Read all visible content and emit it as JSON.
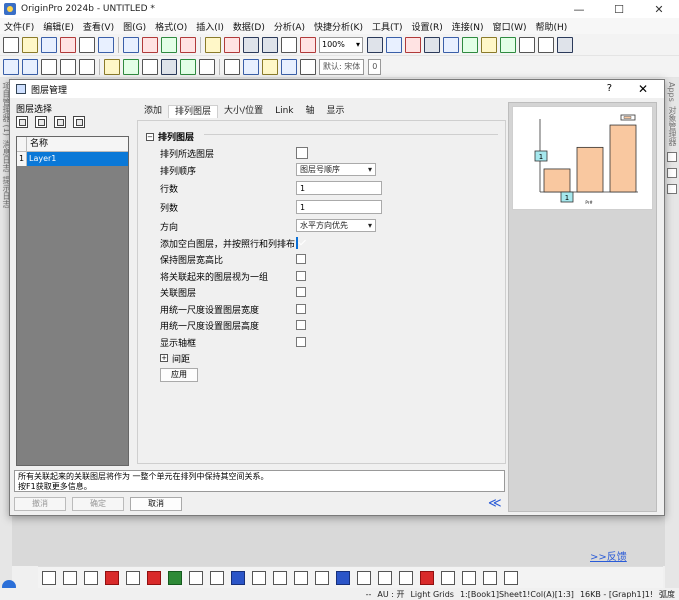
{
  "app": {
    "title": "OriginPro 2024b - UNTITLED *",
    "window_buttons": [
      "—",
      "☐",
      "✕"
    ]
  },
  "menu": [
    "文件(F)",
    "编辑(E)",
    "查看(V)",
    "图(G)",
    "格式(O)",
    "插入(I)",
    "数据(D)",
    "分析(A)",
    "快捷分析(K)",
    "工具(T)",
    "设置(R)",
    "连接(N)",
    "窗口(W)",
    "帮助(H)"
  ],
  "toolbar": {
    "zoom": "100%",
    "font": "默认: 宋体",
    "font_size": "0"
  },
  "side_panels": {
    "left": [
      "项目管理器 (1)",
      "消息日志",
      "提示日志"
    ],
    "right": [
      "Apps",
      "对象管理器"
    ]
  },
  "dialog": {
    "title": "图层管理",
    "help": "?",
    "close": "✕",
    "layer_select_label": "图层选择",
    "list_header": "名称",
    "layers": [
      {
        "index": "1",
        "name": "Layer1"
      }
    ],
    "tabs": [
      "添加",
      "排列图层",
      "大小/位置",
      "Link",
      "轴",
      "显示"
    ],
    "active_tab": "排列图层",
    "group_title": "排列图层",
    "group_expander": "−",
    "rows": {
      "arrange_selected": "排列所选图层",
      "arrange_order": "排列顺序",
      "arrange_order_value": "图层号顺序",
      "rows_label": "行数",
      "rows_value": "1",
      "cols_label": "列数",
      "cols_value": "1",
      "direction": "方向",
      "direction_value": "水平方向优先",
      "add_blank": "添加空白图层，并按照行和列排布",
      "keep_ratio": "保持图层宽高比",
      "treat_linked": "将关联起来的图层视为一组",
      "link_layers": "关联图层",
      "same_width": "用统一尺度设置图层宽度",
      "same_height": "用统一尺度设置图层高度",
      "show_frame": "显示轴框",
      "spacing": "间距",
      "spacing_expander": "+",
      "apply": "应用"
    },
    "checked": {
      "arrange_selected": false,
      "add_blank": true,
      "keep_ratio": false,
      "treat_linked": false,
      "link_layers": false,
      "same_width": false,
      "same_height": false,
      "show_frame": false
    },
    "description": "所有关联起来的关联图层将作为 一整个单元在排列中保持其空间关系。\n按F1获取更多信息。",
    "buttons": {
      "undo": "撤消",
      "ok": "确定",
      "cancel": "取消"
    },
    "collapse": "≪",
    "preview": {
      "legend_text": "",
      "layer_badge": "1",
      "xlabel": "Pr#",
      "bar_values": [
        0.32,
        0.62,
        0.93
      ]
    }
  },
  "feedback": ">>反馈",
  "status": [
    "--",
    "AU : 开",
    "Light Grids",
    "1:[Book1]Sheet1!Col(A)[1:3]",
    "16KB - [Graph1]1!",
    "弧度"
  ],
  "colors": {
    "selection_blue": "#0a78d7",
    "bar_fill": "#f9c8a0",
    "link_blue": "#2a5bd7"
  }
}
